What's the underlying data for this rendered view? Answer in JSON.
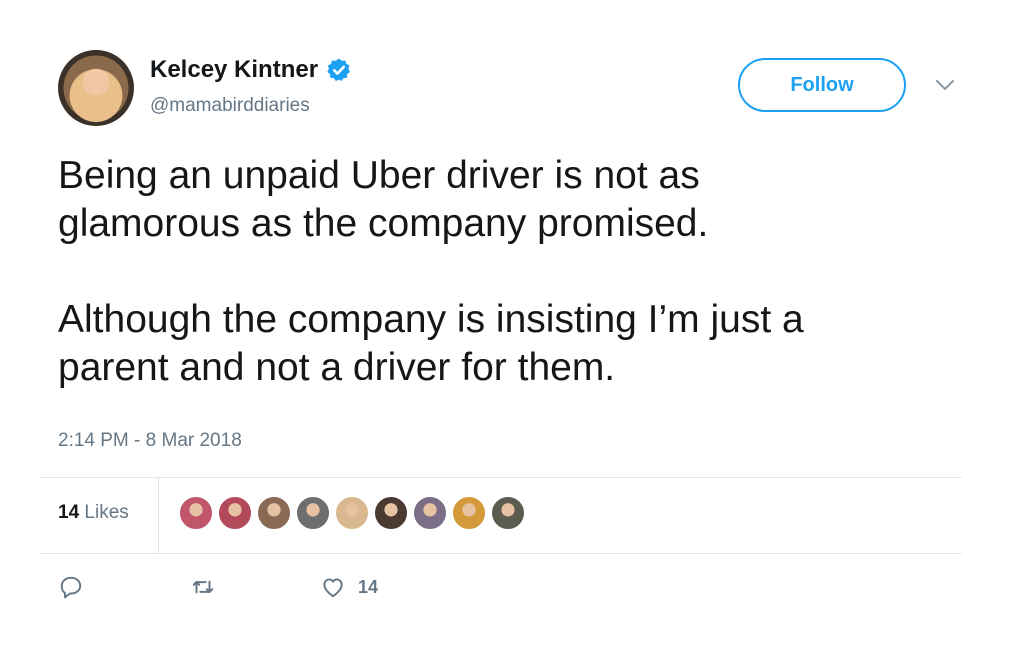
{
  "user": {
    "name": "Kelcey Kintner",
    "handle": "@mamabirddiaries",
    "verified": true
  },
  "follow_label": "Follow",
  "tweet": {
    "text": "Being an unpaid Uber driver is not as\nglamorous as the company promised.\n\nAlthough the company is insisting I’m just a\nparent and not a driver for them.",
    "timestamp": "2:14 PM - 8 Mar 2018"
  },
  "stats": {
    "likes_count": "14",
    "likes_label": "Likes"
  },
  "likers": [
    {
      "color": "#c0566a"
    },
    {
      "color": "#b34a5a"
    },
    {
      "color": "#8b6a55"
    },
    {
      "color": "#6e6e6e"
    },
    {
      "color": "#d9b88f"
    },
    {
      "color": "#4a3a32"
    },
    {
      "color": "#7a6f86"
    },
    {
      "color": "#d49a3a"
    },
    {
      "color": "#5b5b4f"
    }
  ],
  "actions": {
    "like_count": "14"
  },
  "colors": {
    "accent": "#1da1f2",
    "secondary_text": "#657786",
    "divider": "#e1e8ed"
  },
  "icons": [
    "verified-badge-icon",
    "chevron-down-icon",
    "reply-icon",
    "retweet-icon",
    "heart-icon"
  ]
}
